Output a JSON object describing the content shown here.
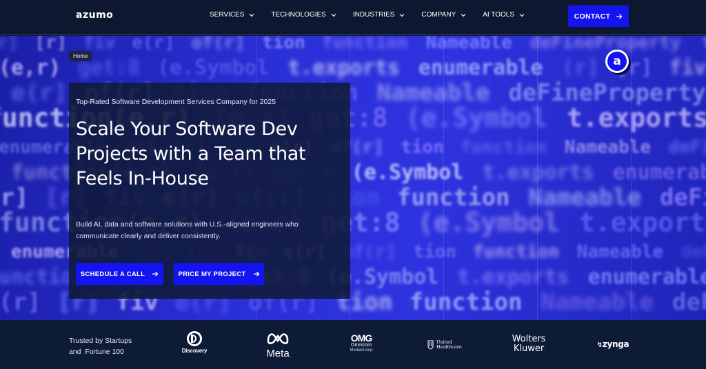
{
  "nav": {
    "logo": "azumo",
    "menu": [
      {
        "label": "SERVICES"
      },
      {
        "label": "TECHNOLOGIES"
      },
      {
        "label": "INDUSTRIES"
      },
      {
        "label": "COMPANY"
      },
      {
        "label": "AI TOOLS"
      }
    ],
    "contact_label": "CONTACT"
  },
  "hero": {
    "breadcrumb": "Home",
    "kicker": "Top-Rated Software Development Services Company for 2025",
    "headline": "Scale Your Software Dev Projects with a Team that Feels In-House",
    "description": "Build AI, data and software solutions with U.S.-aligned engineers who communicate clearly and deliver consistently.",
    "primary_cta": "SCHEDULE A CALL",
    "secondary_cta": "PRICE MY PROJECT",
    "badge_letter": "a",
    "background_code": [
      "(r]",
      "[r]",
      "fiv",
      "e(r]",
      "of(r]",
      "tion",
      "function",
      "Nameable",
      "deFineProperty",
      "function(e,r)",
      "(e,r)",
      "get:8",
      "(e.Symbol",
      "t.exports",
      "enumerable"
    ]
  },
  "trusted": {
    "line1": "Trusted by Startups",
    "line2": "and  Fortune 100",
    "brands": {
      "discovery": "Discovery",
      "meta": "Meta",
      "omg_big": "OMG",
      "omg_l1": "Omnicom",
      "omg_l2": "MediaGroup",
      "uh_l1": "United",
      "uh_l2": "Healthcare",
      "wk_l1": "Wolters",
      "wk_l2": "Kluwer",
      "zynga": "zynga"
    }
  },
  "colors": {
    "accent": "#1414f0",
    "nav_bg": "#0d1830",
    "card_bg": "#101a38"
  }
}
